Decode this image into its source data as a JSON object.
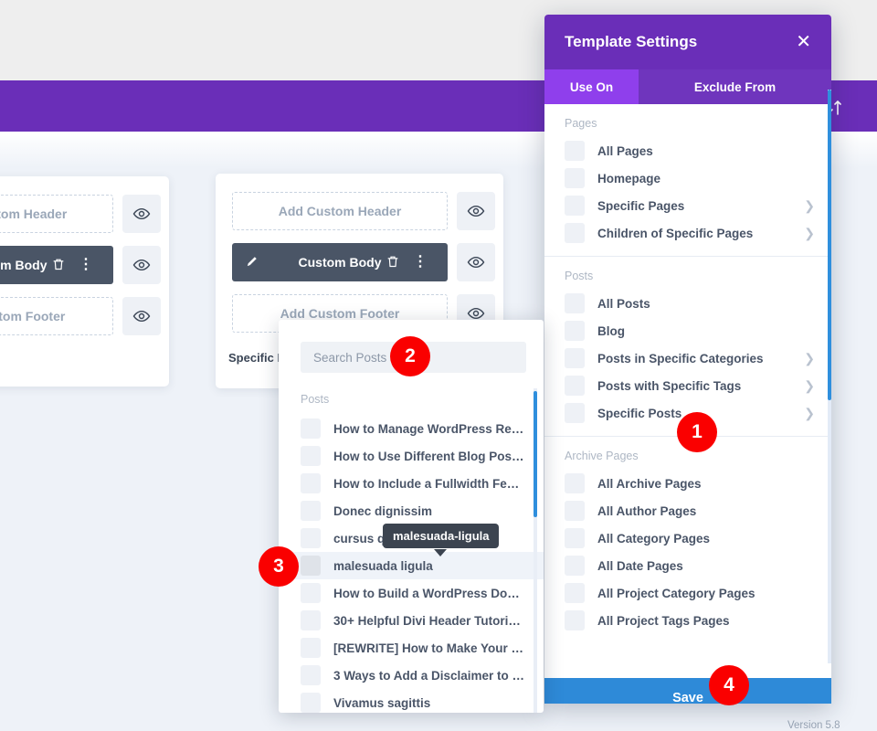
{
  "background": {
    "sort_icon": "sort-arrows-icon",
    "cards": [
      {
        "caption": "",
        "slots": [
          {
            "label": "Add Custom Header",
            "state": "empty"
          },
          {
            "label": "Custom Body",
            "state": "filled"
          },
          {
            "label": "Add Custom Footer",
            "state": "empty"
          }
        ]
      },
      {
        "caption": "Specific P",
        "slots": [
          {
            "label": "Add Custom Header",
            "state": "empty"
          },
          {
            "label": "Custom Body",
            "state": "filled"
          },
          {
            "label": "Add Custom Footer",
            "state": "empty"
          }
        ]
      }
    ],
    "icons": {
      "eye": "eye-icon",
      "pencil": "pencil-icon",
      "trash": "trash-icon",
      "dots": "kebab-menu-icon"
    },
    "version_label": "Version 5.8"
  },
  "modal": {
    "title": "Template Settings",
    "close_icon": "close-icon",
    "tabs": [
      {
        "label": "Use On",
        "active": true
      },
      {
        "label": "Exclude From",
        "active": false
      }
    ],
    "groups": [
      {
        "title": "Pages",
        "options": [
          {
            "label": "All Pages",
            "checked": false,
            "chevron": false
          },
          {
            "label": "Homepage",
            "checked": false,
            "chevron": false
          },
          {
            "label": "Specific Pages",
            "checked": false,
            "chevron": true
          },
          {
            "label": "Children of Specific Pages",
            "checked": false,
            "chevron": true
          }
        ]
      },
      {
        "title": "Posts",
        "options": [
          {
            "label": "All Posts",
            "checked": false,
            "chevron": false
          },
          {
            "label": "Blog",
            "checked": false,
            "chevron": false
          },
          {
            "label": "Posts in Specific Categories",
            "checked": false,
            "chevron": true
          },
          {
            "label": "Posts with Specific Tags",
            "checked": false,
            "chevron": true
          },
          {
            "label": "Specific Posts",
            "checked": false,
            "chevron": true
          }
        ]
      },
      {
        "title": "Archive Pages",
        "options": [
          {
            "label": "All Archive Pages",
            "checked": false,
            "chevron": false
          },
          {
            "label": "All Author Pages",
            "checked": false,
            "chevron": false
          },
          {
            "label": "All Category Pages",
            "checked": false,
            "chevron": false
          },
          {
            "label": "All Date Pages",
            "checked": false,
            "chevron": false
          },
          {
            "label": "All Project Category Pages",
            "checked": false,
            "chevron": false
          },
          {
            "label": "All Project Tags Pages",
            "checked": false,
            "chevron": false
          }
        ]
      }
    ],
    "save_label": "Save"
  },
  "search_popover": {
    "search_placeholder": "Search Posts",
    "search_value": "",
    "group_title": "Posts",
    "tooltip": "malesuada-ligula",
    "posts": [
      {
        "label": "How to Manage WordPress Re…",
        "highlighted": false
      },
      {
        "label": "How to Use Different Blog Pos…",
        "highlighted": false
      },
      {
        "label": "How to Include a Fullwidth Fe…",
        "highlighted": false
      },
      {
        "label": "Donec dignissim",
        "highlighted": false
      },
      {
        "label": "cursus q",
        "highlighted": false
      },
      {
        "label": "malesuada ligula",
        "highlighted": true
      },
      {
        "label": "How to Build a WordPress Don…",
        "highlighted": false
      },
      {
        "label": "30+ Helpful Divi Header Tutori…",
        "highlighted": false
      },
      {
        "label": "[REWRITE] How to Make Your …",
        "highlighted": false
      },
      {
        "label": "3 Ways to Add a Disclaimer to …",
        "highlighted": false
      },
      {
        "label": "Vivamus sagittis",
        "highlighted": false
      }
    ]
  },
  "badges": [
    {
      "number": "1"
    },
    {
      "number": "2"
    },
    {
      "number": "3"
    },
    {
      "number": "4"
    }
  ],
  "colors": {
    "brand_purple": "#6a2eb8",
    "active_tab_purple": "#8f3fec",
    "save_blue": "#2e8ad8",
    "badge_red": "#fa0000",
    "slot_dark": "#4a5566"
  }
}
